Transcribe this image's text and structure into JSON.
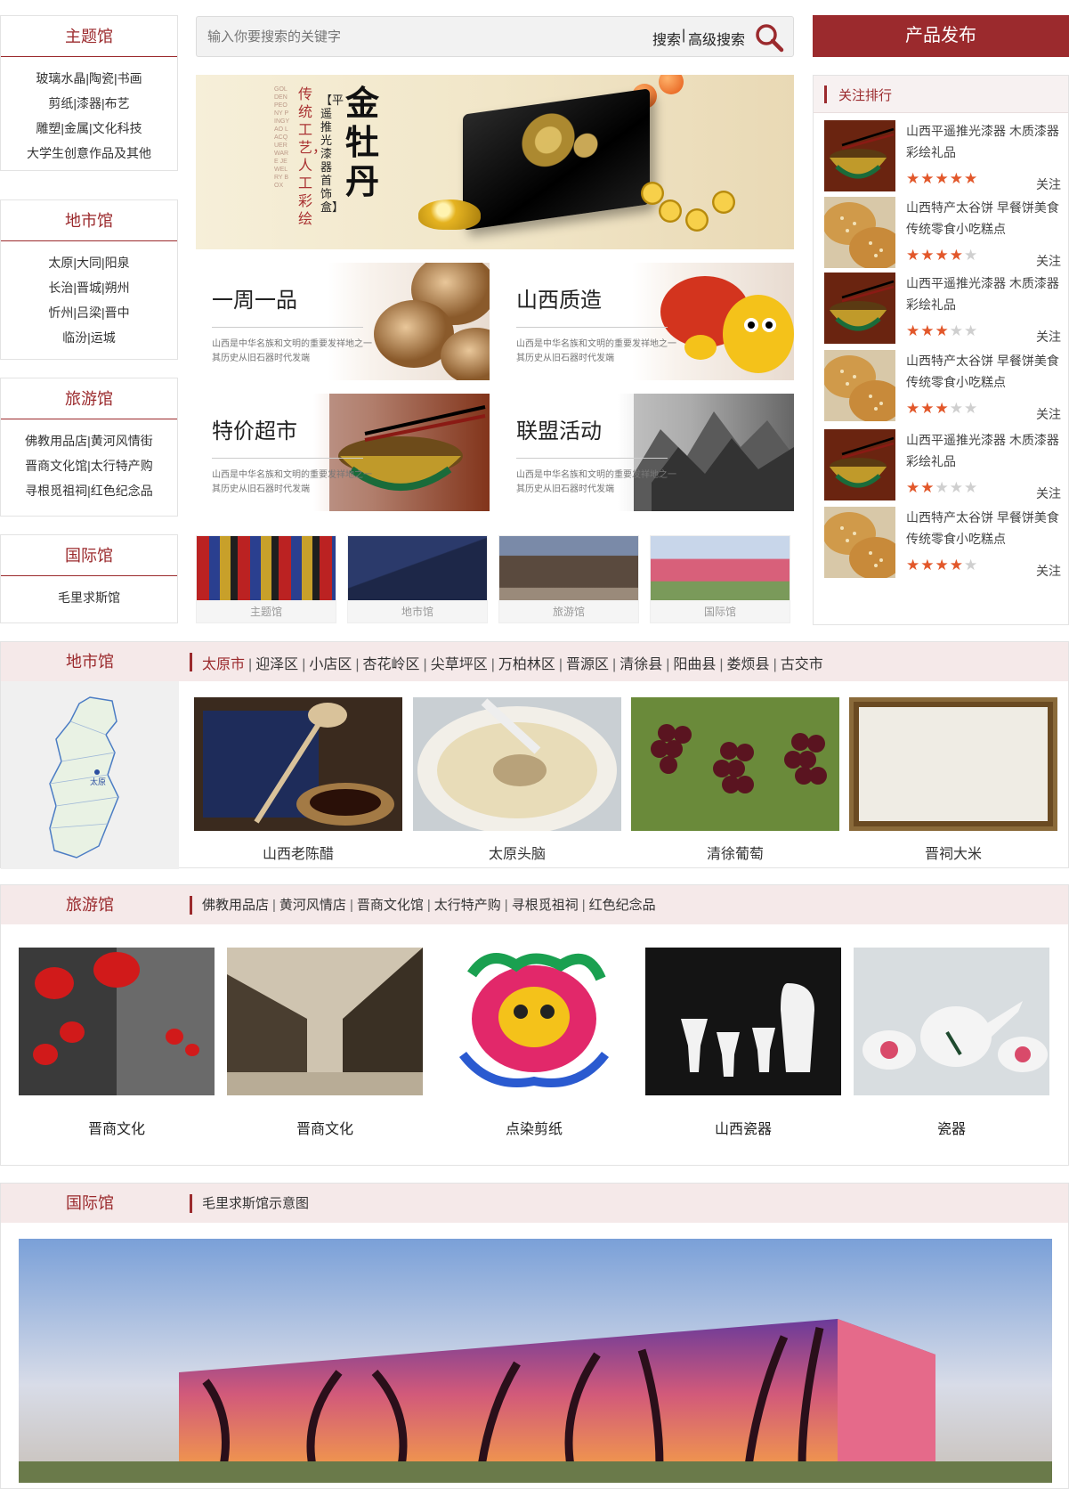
{
  "left_boxes": [
    {
      "title": "主题馆",
      "lines": [
        "玻璃水晶|陶瓷|书画",
        "剪纸|漆器|布艺",
        "雕塑|金属|文化科技",
        "大学生创意作品及其他"
      ]
    },
    {
      "title": "地市馆",
      "lines": [
        "太原|大同|阳泉",
        "长治|晋城|朔州",
        "忻州|吕梁|晋中",
        "临汾|运城"
      ]
    },
    {
      "title": "旅游馆",
      "lines": [
        "佛教用品店|黄河风情街",
        "晋商文化馆|太行特产购",
        "寻根觅祖祠|红色纪念品"
      ]
    },
    {
      "title": "国际馆",
      "lines": [
        "毛里求斯馆"
      ]
    }
  ],
  "search": {
    "placeholder": "输入你要搜索的关键字",
    "search_label": "搜索",
    "advanced_label": "高级搜索",
    "icon": "search-icon"
  },
  "publish_label": "产品发布",
  "banner": {
    "headline": "金牡丹",
    "vertical_a": "传统工艺，人工彩绘",
    "vertical_b": "【平遥推光漆器首饰盒】",
    "english": "GOLDEN PEONY PINGYAO LACQUERWARE JEWELRY BOX"
  },
  "tiles": [
    {
      "title": "一周一品",
      "desc1": "山西是中华名族和文明的重要发祥地之一",
      "desc2": "其历史从旧石器时代发端"
    },
    {
      "title": "山西质造",
      "desc1": "山西是中华名族和文明的重要发祥地之一",
      "desc2": "其历史从旧石器时代发端"
    },
    {
      "title": "特价超市",
      "desc1": "山西是中华名族和文明的重要发祥地之一",
      "desc2": "其历史从旧石器时代发端"
    },
    {
      "title": "联盟活动",
      "desc1": "山西是中华名族和文明的重要发祥地之一",
      "desc2": "其历史从旧石器时代发端"
    }
  ],
  "thumbs": [
    "主题馆",
    "地市馆",
    "旅游馆",
    "国际馆"
  ],
  "ranking": {
    "title": "关注排行",
    "follow_label": "关注",
    "items": [
      {
        "name": "山西平遥推光漆器 木质漆器彩绘礼品",
        "rating": 4.5,
        "stars": "★★★★★"
      },
      {
        "name": "山西特产太谷饼 早餐饼美食传统零食小吃糕点",
        "rating": 4,
        "stars": "★★★★★"
      },
      {
        "name": "山西平遥推光漆器 木质漆器彩绘礼品",
        "rating": 3,
        "stars": "★★★★★"
      },
      {
        "name": "山西特产太谷饼 早餐饼美食传统零食小吃糕点",
        "rating": 3,
        "stars": "★★★★★"
      },
      {
        "name": "山西平遥推光漆器 木质漆器彩绘礼品",
        "rating": 2,
        "stars": "★★★★★"
      },
      {
        "name": "山西特产太谷饼 早餐饼美食传统零食小吃糕点",
        "rating": 4,
        "stars": "★★★★★"
      }
    ]
  },
  "city_section": {
    "title": "地市馆",
    "links": [
      "太原市",
      "迎泽区",
      "小店区",
      "杏花岭区",
      "尖草坪区",
      "万柏林区",
      "晋源区",
      "清徐县",
      "阳曲县",
      "娄烦县",
      "古交市"
    ],
    "map_label": "太原",
    "products": [
      "山西老陈醋",
      "太原头脑",
      "清徐葡萄",
      "晋祠大米"
    ]
  },
  "tour_section": {
    "title": "旅游馆",
    "links": [
      "佛教用品店",
      "黄河风情店",
      "晋商文化馆",
      "太行特产购",
      "寻根觅祖祠",
      "红色纪念品"
    ],
    "products": [
      "晋商文化",
      "晋商文化",
      "点染剪纸",
      "山西瓷器",
      "瓷器"
    ]
  },
  "intl_section": {
    "title": "国际馆",
    "link": "毛里求斯馆示意图"
  },
  "colors": {
    "accent": "#9b2a2d",
    "header_bg": "#f5e9e9",
    "star_on": "#e2572a",
    "star_off": "#cfcfcf"
  }
}
